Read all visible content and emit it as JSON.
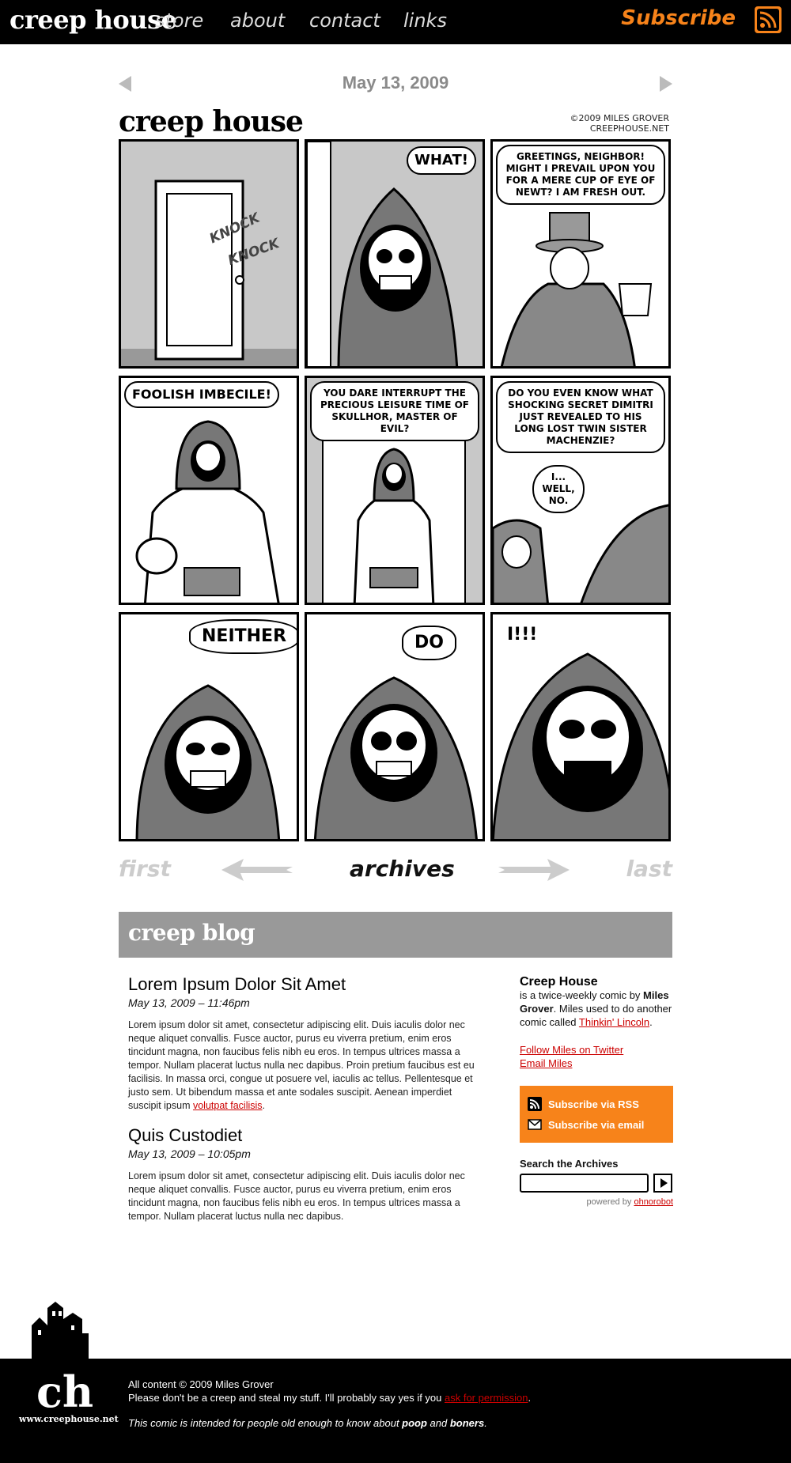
{
  "header": {
    "logo": "creep house",
    "nav": [
      "store",
      "about",
      "contact",
      "links"
    ],
    "subscribe_label": "Subscribe",
    "accent_color": "#f7831a"
  },
  "comic": {
    "date": "May 13, 2009",
    "title": "creep house",
    "credit_line1": "©2009 MILES GROVER",
    "credit_line2": "CREEPHOUSE.NET",
    "panels": [
      {
        "text": "",
        "fx1": "KNOCK",
        "fx2": "KNOCK"
      },
      {
        "text": "WHAT!"
      },
      {
        "text": "GREETINGS, NEIGHBOR! MIGHT I PREVAIL UPON YOU FOR A MERE CUP OF EYE OF NEWT? I AM FRESH OUT."
      },
      {
        "text": "FOOLISH IMBECILE!"
      },
      {
        "text": "YOU DARE INTERRUPT THE PRECIOUS LEISURE TIME OF SKULLHOR, MASTER OF EVIL?"
      },
      {
        "text": "DO YOU EVEN KNOW WHAT SHOCKING SECRET DIMITRI JUST REVEALED TO HIS LONG LOST TWIN SISTER MACHENZIE?",
        "text2": "I... WELL, NO."
      },
      {
        "text": "NEITHER"
      },
      {
        "text": "DO"
      },
      {
        "text": "I!!!"
      }
    ],
    "nav": {
      "first": "first",
      "archives": "archives",
      "last": "last"
    }
  },
  "blog": {
    "header": "creep blog",
    "posts": [
      {
        "title": "Lorem Ipsum Dolor Sit Amet",
        "meta": "May 13, 2009 – 11:46pm",
        "body": "Lorem ipsum dolor sit amet, consectetur adipiscing elit. Duis iaculis dolor nec neque aliquet convallis. Fusce auctor, purus eu viverra pretium, enim eros tincidunt magna, non faucibus felis nibh eu eros. In tempus ultrices massa a tempor. Nullam placerat luctus nulla nec dapibus. Proin pretium faucibus est eu facilisis. In massa orci, congue ut posuere vel, iaculis ac tellus. Pellentesque et justo sem. Ut bibendum massa et ante sodales suscipit. Aenean imperdiet suscipit ipsum ",
        "link": "volutpat facilisis",
        "tail": "."
      },
      {
        "title": "Quis Custodiet",
        "meta": "May 13, 2009 – 10:05pm",
        "body": "Lorem ipsum dolor sit amet, consectetur adipiscing elit. Duis iaculis dolor nec neque aliquet convallis. Fusce auctor, purus eu viverra pretium, enim eros tincidunt magna, non faucibus felis nibh eu eros. In tempus ultrices massa a tempor. Nullam placerat luctus nulla nec dapibus."
      }
    ]
  },
  "sidebar": {
    "title": "Creep House",
    "desc1": "is a twice-weekly comic by ",
    "author": "Miles Grover",
    "desc2": ". Miles used to do another comic called ",
    "prev_comic": "Thinkin' Lincoln",
    "desc3": ".",
    "twitter": "Follow Miles on Twitter",
    "email": "Email Miles",
    "rss": "Subscribe via RSS",
    "email_sub": "Subscribe via email",
    "search_label": "Search the Archives",
    "powered_prefix": "powered by ",
    "powered_link": "ohnorobot"
  },
  "footer": {
    "logo": "ch",
    "site": "www.creephouse.net",
    "copyright": "All content © 2009 Miles Grover",
    "line2": "Please don't be a creep and steal my stuff. I'll probably say yes if you ",
    "permission": "ask for permission",
    "line2_tail": ".",
    "note_pre": "This comic is intended for people old enough to know about ",
    "word1": "poop",
    "note_mid": " and ",
    "word2": "boners",
    "note_tail": "."
  }
}
